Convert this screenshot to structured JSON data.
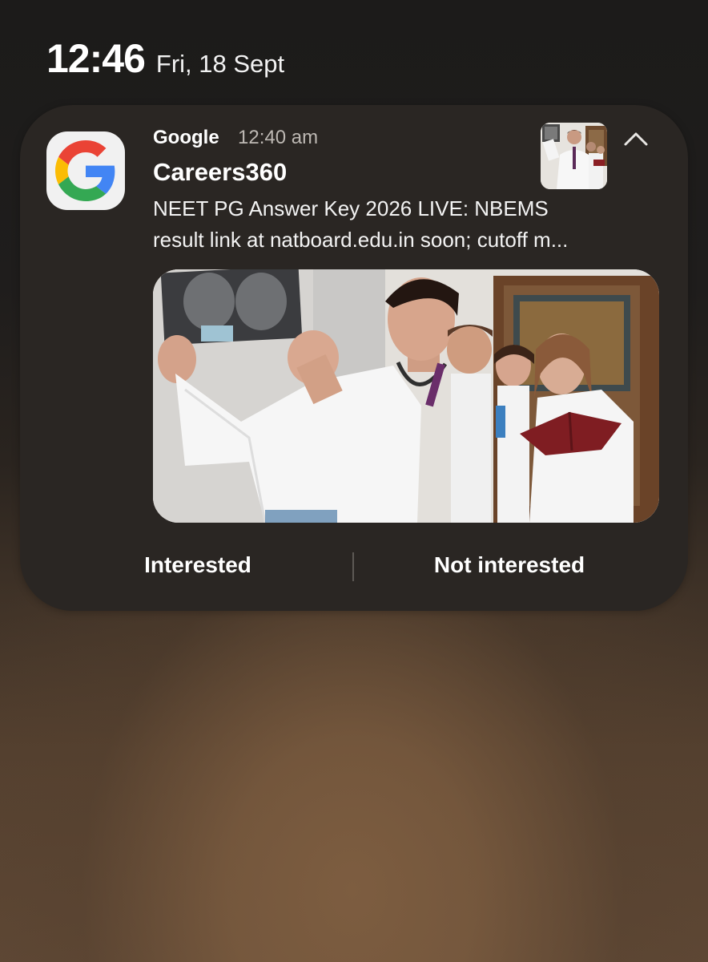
{
  "status_bar": {
    "time": "12:46",
    "date": "Fri, 18 Sept"
  },
  "notification": {
    "app_name": "Google",
    "time": "12:40 am",
    "title": "Careers360",
    "body_line1": "NEET PG Answer Key 2026 LIVE: NBEMS",
    "body_line2": "result link at natboard.edu.in soon; cutoff m...",
    "app_icon": "google-g-icon",
    "collapse_icon": "chevron-up-icon",
    "actions": {
      "interested": "Interested",
      "not_interested": "Not interested"
    }
  },
  "colors": {
    "card_background": "#2a2623",
    "text_primary": "#ffffff",
    "text_secondary": "#bdb8b3",
    "google_blue": "#4285F4",
    "google_red": "#EA4335",
    "google_yellow": "#FBBC05",
    "google_green": "#34A853"
  }
}
